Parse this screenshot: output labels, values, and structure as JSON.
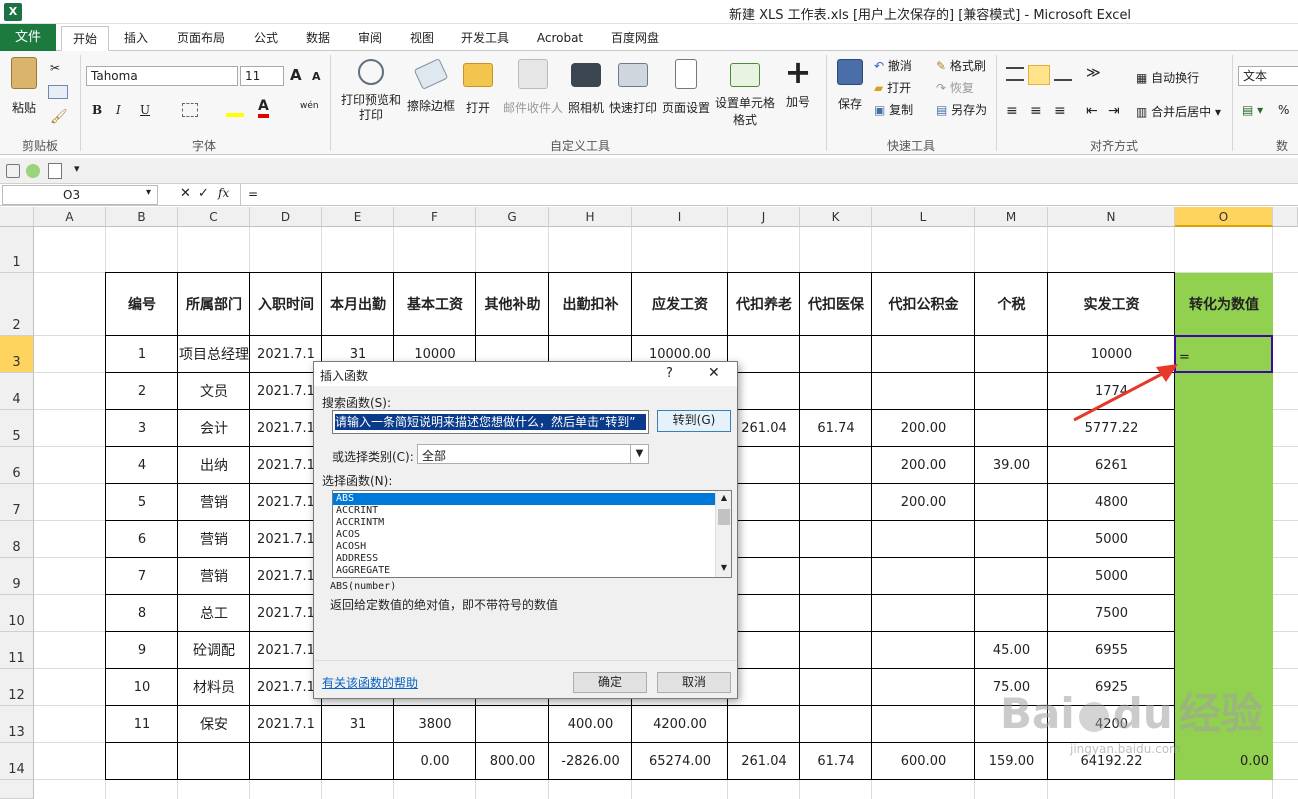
{
  "window": {
    "title": "新建 XLS 工作表.xls [用户上次保存的] [兼容模式] - Microsoft Excel",
    "app_icon": "X"
  },
  "tabs": {
    "file": "文件",
    "items": [
      "开始",
      "插入",
      "页面布局",
      "公式",
      "数据",
      "审阅",
      "视图",
      "开发工具",
      "Acrobat",
      "百度网盘"
    ]
  },
  "ribbon": {
    "clipboard": {
      "label": "剪贴板",
      "paste": "粘贴"
    },
    "font": {
      "label": "字体",
      "name": "Tahoma",
      "size": "11",
      "grow": "A",
      "shrink": "A",
      "bold": "B",
      "italic": "I",
      "underline": "U",
      "color_letter": "A",
      "wen": "wén"
    },
    "custom": {
      "label": "自定义工具",
      "buttons": [
        "打印预览和打印",
        "擦除边框",
        "打开",
        "邮件收件人",
        "照相机",
        "快速打印",
        "页面设置",
        "设置单元格格式",
        "加号"
      ]
    },
    "quick": {
      "label": "快速工具",
      "save": "保存",
      "undo": "撤消",
      "open": "打开",
      "copy": "复制",
      "format_painter": "格式刷",
      "redo": "恢复",
      "save_as": "另存为"
    },
    "align": {
      "label": "对齐方式",
      "wrap": "自动换行",
      "merge": "合并后居中"
    },
    "number": {
      "label": "数",
      "format": "文本",
      "percent": "%"
    }
  },
  "formula_bar": {
    "name_box": "O3",
    "fx": "fx",
    "formula": "="
  },
  "columns": [
    "A",
    "B",
    "C",
    "D",
    "E",
    "F",
    "G",
    "H",
    "I",
    "J",
    "K",
    "L",
    "M",
    "N",
    "O"
  ],
  "rows": [
    "1",
    "2",
    "3",
    "4",
    "5",
    "6",
    "7",
    "8",
    "9",
    "10",
    "11",
    "12",
    "13",
    "14"
  ],
  "table": {
    "headers": [
      "编号",
      "所属部门",
      "入职时间",
      "本月出勤",
      "基本工资",
      "其他补助",
      "出勤扣补",
      "应发工资",
      "代扣养老",
      "代扣医保",
      "代扣公积金",
      "个税",
      "实发工资",
      "转化为数值"
    ],
    "data": [
      [
        "1",
        "项目总经理",
        "2021.7.1",
        "31",
        "10000",
        "",
        "",
        "10000.00",
        "",
        "",
        "",
        "",
        "10000",
        "="
      ],
      [
        "2",
        "文员",
        "2021.7.1",
        "",
        "",
        "",
        "",
        "",
        "",
        "",
        "",
        "",
        "1774",
        ""
      ],
      [
        "3",
        "会计",
        "2021.7.1",
        "",
        "",
        "",
        "",
        "",
        "261.04",
        "61.74",
        "200.00",
        "",
        "5777.22",
        ""
      ],
      [
        "4",
        "出纳",
        "2021.7.1",
        "",
        "",
        "",
        "",
        "",
        "",
        "",
        "200.00",
        "39.00",
        "6261",
        ""
      ],
      [
        "5",
        "营销",
        "2021.7.1",
        "",
        "",
        "",
        "",
        "",
        "",
        "",
        "200.00",
        "",
        "4800",
        ""
      ],
      [
        "6",
        "营销",
        "2021.7.1",
        "",
        "",
        "",
        "",
        "",
        "",
        "",
        "",
        "",
        "5000",
        ""
      ],
      [
        "7",
        "营销",
        "2021.7.1",
        "",
        "",
        "",
        "",
        "",
        "",
        "",
        "",
        "",
        "5000",
        ""
      ],
      [
        "8",
        "总工",
        "2021.7.1",
        "",
        "",
        "",
        "",
        "",
        "",
        "",
        "",
        "",
        "7500",
        ""
      ],
      [
        "9",
        "砼调配",
        "2021.7.1",
        "",
        "",
        "",
        "",
        "",
        "",
        "",
        "",
        "45.00",
        "6955",
        ""
      ],
      [
        "10",
        "材料员",
        "2021.7.1",
        "",
        "",
        "",
        "",
        "",
        "",
        "",
        "",
        "75.00",
        "6925",
        ""
      ],
      [
        "11",
        "保安",
        "2021.7.1",
        "31",
        "3800",
        "",
        "400.00",
        "4200.00",
        "",
        "",
        "",
        "",
        "4200",
        ""
      ],
      [
        "",
        "",
        "",
        "",
        "0.00",
        "800.00",
        "-2826.00",
        "65274.00",
        "261.04",
        "61.74",
        "600.00",
        "159.00",
        "64192.22",
        "0.00"
      ]
    ]
  },
  "dialog": {
    "title": "插入函数",
    "help_q": "?",
    "close": "✕",
    "search_label": "搜索函数(S):",
    "search_value": "请输入一条简短说明来描述您想做什么，然后单击“转到”",
    "goto": "转到(G)",
    "category_label": "或选择类别(C):",
    "category_value": "全部",
    "select_label": "选择函数(N):",
    "functions": [
      "ABS",
      "ACCRINT",
      "ACCRINTM",
      "ACOS",
      "ACOSH",
      "ADDRESS",
      "AGGREGATE"
    ],
    "signature": "ABS(number)",
    "description": "返回给定数值的绝对值，即不带符号的数值",
    "help_link": "有关该函数的帮助",
    "ok": "确定",
    "cancel": "取消"
  },
  "watermark": {
    "brand": "Bai",
    "du": "du",
    "jingyan": "经验",
    "url": "jingyan.baidu.com"
  },
  "colors": {
    "green_col": "#92d050",
    "excel_green": "#1d7a3f",
    "arrow": "#e83828",
    "selection": "#3b0ba0"
  }
}
